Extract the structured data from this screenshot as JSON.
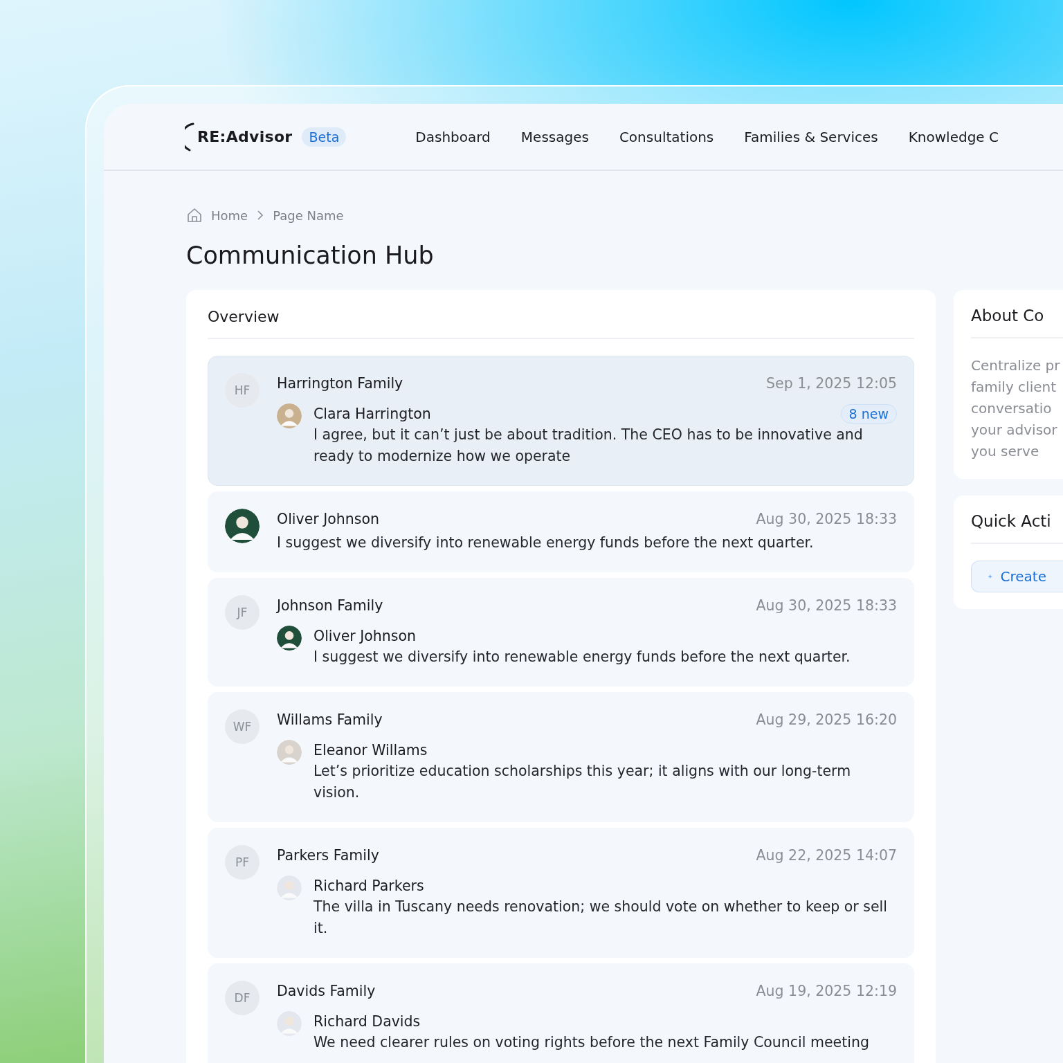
{
  "header": {
    "logo": "RE:Advisor",
    "badge": "Beta",
    "nav": [
      "Dashboard",
      "Messages",
      "Consultations",
      "Families & Services",
      "Knowledge C"
    ]
  },
  "breadcrumb": [
    "Home",
    "Page Name"
  ],
  "title": "Communication Hub",
  "overview": {
    "title": "Overview",
    "threads": [
      {
        "kind": "family",
        "selected": true,
        "initials": "HF",
        "name": "Harrington Family",
        "time": "Sep 1, 2025 12:05",
        "member": "Clara Harrington",
        "badge": "8 new",
        "message": "I agree, but it can’t just be about tradition. The CEO has to be innovative and ready to modernize how we operate"
      },
      {
        "kind": "person",
        "selected": false,
        "name": "Oliver Johnson",
        "time": "Aug 30, 2025 18:33",
        "message": "I suggest we diversify into renewable energy funds before the next quarter."
      },
      {
        "kind": "family",
        "selected": false,
        "initials": "JF",
        "name": "Johnson Family",
        "time": "Aug 30, 2025 18:33",
        "member": "Oliver Johnson",
        "message": "I suggest we diversify into renewable energy funds before the next quarter."
      },
      {
        "kind": "family",
        "selected": false,
        "initials": "WF",
        "name": "Willams Family",
        "time": "Aug 29, 2025 16:20",
        "member": "Eleanor Willams",
        "message": "Let’s prioritize education scholarships this year; it aligns with our long-term vision."
      },
      {
        "kind": "family",
        "selected": false,
        "initials": "PF",
        "name": "Parkers Family",
        "time": "Aug 22, 2025 14:07",
        "member": "Richard Parkers",
        "message": "The villa in Tuscany needs renovation; we should vote on whether to keep or sell it."
      },
      {
        "kind": "family",
        "selected": false,
        "initials": "DF",
        "name": "Davids Family",
        "time": "Aug 19, 2025 12:19",
        "member": "Richard Davids",
        "message": "We need clearer rules on voting rights before the next Family Council meeting"
      }
    ]
  },
  "about": {
    "title": "About Co",
    "lines": [
      "Centralize pr",
      "family client",
      "conversatio",
      "your advisor",
      "you serve"
    ]
  },
  "quick_actions": {
    "title": "Quick Acti",
    "button": "Create"
  }
}
